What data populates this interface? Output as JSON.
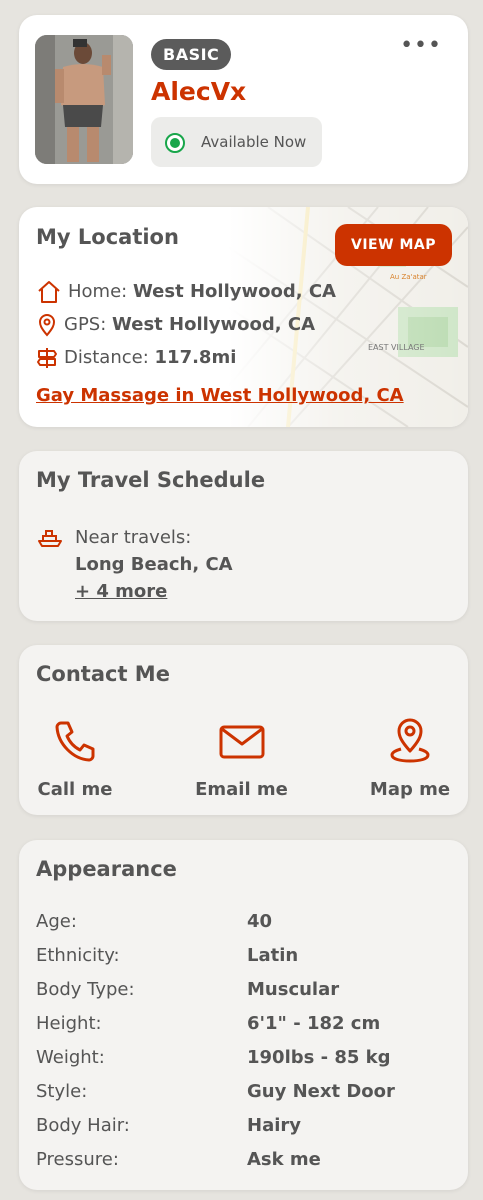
{
  "profile": {
    "badge": "BASIC",
    "username": "AlecVx",
    "status": "Available Now",
    "menu_glyph": "•••"
  },
  "location": {
    "title": "My Location",
    "view_map_label": "VIEW MAP",
    "home_label": "Home:",
    "home_value": "West Hollywood, CA",
    "gps_label": "GPS:",
    "gps_value": "West Hollywood, CA",
    "distance_label": "Distance:",
    "distance_value": "117.8mi",
    "link_text": "Gay Massage in West Hollywood, CA",
    "map_labels": {
      "area": "EAST VILLAGE",
      "poi": "Au Za'atar"
    }
  },
  "travel": {
    "title": "My Travel Schedule",
    "near_label": "Near travels:",
    "destination": "Long Beach, CA",
    "more_link": "+ 4 more"
  },
  "contact": {
    "title": "Contact Me",
    "call_label": "Call me",
    "email_label": "Email me",
    "map_label": "Map me"
  },
  "appearance": {
    "title": "Appearance",
    "rows": [
      {
        "key": "Age:",
        "value": "40"
      },
      {
        "key": "Ethnicity:",
        "value": "Latin"
      },
      {
        "key": "Body Type:",
        "value": "Muscular"
      },
      {
        "key": "Height:",
        "value": "6'1\" - 182 cm"
      },
      {
        "key": "Weight:",
        "value": "190lbs - 85 kg"
      },
      {
        "key": "Style:",
        "value": "Guy Next Door"
      },
      {
        "key": "Body Hair:",
        "value": "Hairy"
      },
      {
        "key": "Pressure:",
        "value": "Ask me"
      }
    ]
  },
  "colors": {
    "accent": "#cc3300",
    "available": "#18a64a",
    "badge_bg": "#5b5b5b",
    "page_bg": "#e6e4df"
  }
}
